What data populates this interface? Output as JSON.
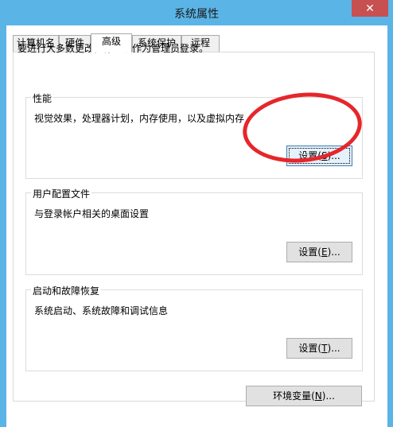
{
  "window": {
    "title": "系统属性",
    "close_symbol": "✕"
  },
  "tabs": [
    {
      "label": "计算机名",
      "active": false
    },
    {
      "label": "硬件",
      "active": false
    },
    {
      "label": "高级",
      "active": true
    },
    {
      "label": "系统保护",
      "active": false
    },
    {
      "label": "远程",
      "active": false
    }
  ],
  "advanced": {
    "intro": "要进行大多数更改，你必须作为管理员登录。",
    "performance": {
      "label": "性能",
      "description": "视觉效果，处理器计划，内存使用，以及虚拟内存",
      "button_prefix": "设置(",
      "button_key": "S",
      "button_suffix": ")..."
    },
    "user_profiles": {
      "label": "用户配置文件",
      "description": "与登录帐户相关的桌面设置",
      "button_prefix": "设置(",
      "button_key": "E",
      "button_suffix": ")..."
    },
    "startup_recovery": {
      "label": "启动和故障恢复",
      "description": "系统启动、系统故障和调试信息",
      "button_prefix": "设置(",
      "button_key": "T",
      "button_suffix": ")..."
    },
    "env_button": {
      "prefix": "环境变量(",
      "key": "N",
      "suffix": ")..."
    }
  },
  "colors": {
    "title_bar": "#5bb4e6",
    "close_button": "#c75050",
    "annotation_circle": "#e6262b"
  }
}
